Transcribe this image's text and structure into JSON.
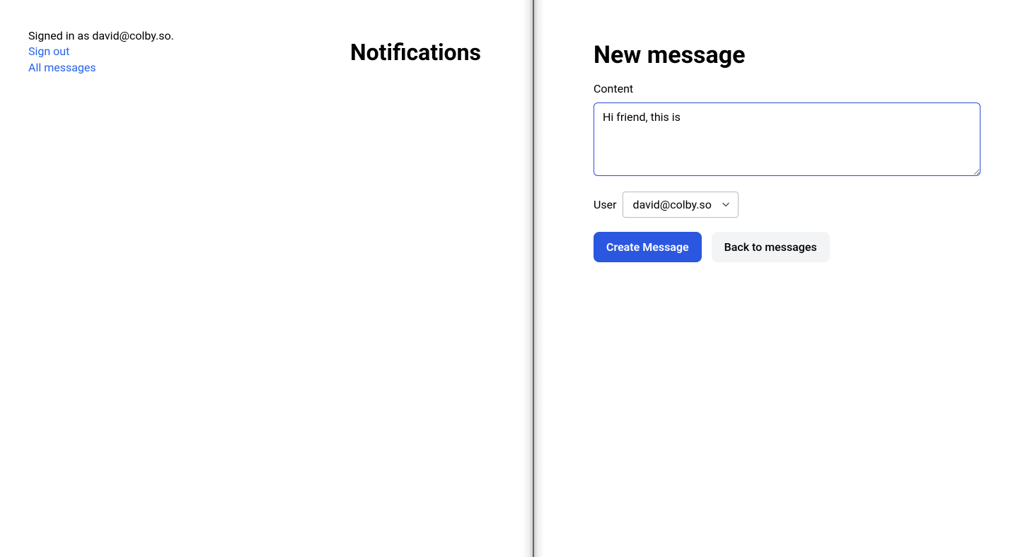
{
  "left": {
    "auth": {
      "signed_in_text": "Signed in as david@colby.so.",
      "sign_out_label": "Sign out",
      "all_messages_label": "All messages"
    },
    "notifications_heading": "Notifications"
  },
  "right": {
    "heading": "New message",
    "content_label": "Content",
    "content_value": "Hi friend, this is",
    "user_label": "User",
    "user_selected": "david@colby.so",
    "create_button": "Create Message",
    "back_button": "Back to messages"
  }
}
